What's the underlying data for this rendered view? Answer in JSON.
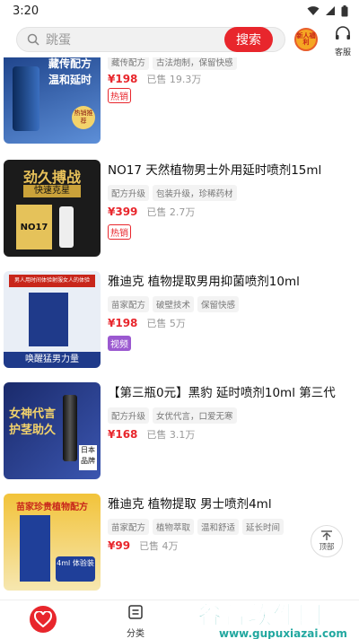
{
  "status_bar": {
    "time": "3:20"
  },
  "header": {
    "search_placeholder": "跳蛋",
    "search_button": "搜索",
    "badge_text": "新人福利",
    "service_label": "客服"
  },
  "products": [
    {
      "title": "",
      "tags": [
        "藏传配方",
        "古法炮制，保留快感"
      ],
      "price": "¥198",
      "sold": "已售 19.3万",
      "label": "热销",
      "label_type": "hot",
      "thumb_text": [
        "藏传配方",
        "温和延时",
        "热销推荐"
      ],
      "thumb_colors": [
        "#123a7a",
        "#4b7fd1"
      ]
    },
    {
      "title": "NO17  天然植物男士外用延时喷剂15ml",
      "tags": [
        "配方升级",
        "包装升级，珍稀药材"
      ],
      "price": "¥399",
      "sold": "已售 2.7万",
      "label": "热销",
      "label_type": "hot",
      "thumb_text": [
        "劲久搏战",
        "快速克星",
        "NO17"
      ],
      "thumb_colors": [
        "#1b1b1b",
        "#caa23a"
      ]
    },
    {
      "title": "雅迪克 植物提取男用抑菌喷剂10ml",
      "tags": [
        "苗家配方",
        "破壁技术",
        "保留快感"
      ],
      "price": "¥198",
      "sold": "已售 5万",
      "label": "视频",
      "label_type": "video",
      "thumb_text": [
        "男人用时间体验射服女人的体验",
        "唤醒猛男力量"
      ],
      "thumb_colors": [
        "#e9eef6",
        "#1f3a8a"
      ]
    },
    {
      "title": "【第三瓶0元】黑豹 延时喷剂10ml 第三代",
      "tags": [
        "配方升级",
        "女优代言，口爱无寒"
      ],
      "price": "¥168",
      "sold": "已售 3.1万",
      "label": "",
      "label_type": "",
      "thumb_text": [
        "女神代言",
        "护茎助久",
        "日本品牌"
      ],
      "thumb_colors": [
        "#1a2a6b",
        "#e5c24a"
      ]
    },
    {
      "title": "雅迪克 植物提取 男士喷剂4ml",
      "tags": [
        "苗家配方",
        "植物萃取",
        "温和舒适",
        "延长时间"
      ],
      "price": "¥99",
      "sold": "已售 4万",
      "label": "",
      "label_type": "",
      "thumb_text": [
        "苗家珍贵植物配方",
        "4ml 体验装"
      ],
      "thumb_colors": [
        "#f2c33a",
        "#1f3f99"
      ]
    }
  ],
  "to_top_label": "顶部",
  "nav": {
    "category_label": "分类"
  },
  "watermark": {
    "main": "谷普软件园",
    "url": "www.gupuxiazai.com"
  }
}
